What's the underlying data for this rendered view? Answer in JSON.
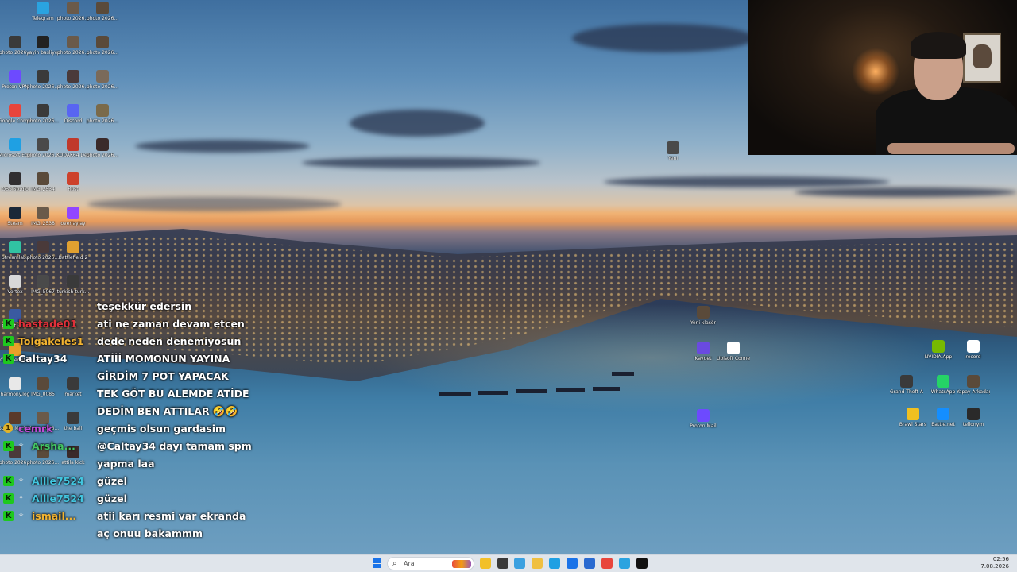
{
  "desktop": {
    "left_icons": [
      {
        "label": "Telegram",
        "icon": "telegram-icon",
        "color": "#2aa3e0"
      },
      {
        "label": "photo 2026...",
        "icon": "photo-icon",
        "color": "#6a5a4a"
      },
      {
        "label": "photo 2026...",
        "icon": "photo-icon",
        "color": "#5a4a3a"
      },
      {
        "label": "photo 2026...",
        "icon": "photo-icon",
        "color": "#3a3a3a"
      },
      {
        "label": "yayin basliyor",
        "icon": "video-icon",
        "color": "#222222"
      },
      {
        "label": "photo 2026...",
        "icon": "photo-icon",
        "color": "#6a5a4a"
      },
      {
        "label": "photo 2026...",
        "icon": "photo-icon",
        "color": "#5a4a3a"
      },
      {
        "label": "Proton VPN",
        "icon": "proton-vpn-icon",
        "color": "#6d4aff"
      },
      {
        "label": "photo 2026...",
        "icon": "photo-icon",
        "color": "#3a3a3a"
      },
      {
        "label": "photo 2026...",
        "icon": "photo-icon",
        "color": "#4a3a3a"
      },
      {
        "label": "photo 2026...",
        "icon": "photo-icon",
        "color": "#7a6a5a"
      },
      {
        "label": "Google Chrome",
        "icon": "chrome-icon",
        "color": "#e8453c"
      },
      {
        "label": "photo 2026...",
        "icon": "photo-icon",
        "color": "#3a3a3a"
      },
      {
        "label": "Discord",
        "icon": "discord-icon",
        "color": "#5865f2"
      },
      {
        "label": "photo 2026...",
        "icon": "photo-icon",
        "color": "#7a6a4a"
      },
      {
        "label": "Microsoft Edge",
        "icon": "edge-icon",
        "color": "#1fa0e3"
      },
      {
        "label": "photo 2026...",
        "icon": "photo-icon",
        "color": "#4a4a4a"
      },
      {
        "label": "KODAK64 Desktop",
        "icon": "kodak-icon",
        "color": "#c0392b"
      },
      {
        "label": "photo 2026...",
        "icon": "photo-icon",
        "color": "#3a2a2a"
      },
      {
        "label": "OBS Studio",
        "icon": "obs-icon",
        "color": "#302e31"
      },
      {
        "label": "IMG_2534",
        "icon": "photo-icon",
        "color": "#5a4a3a"
      },
      {
        "label": "Rust",
        "icon": "rust-icon",
        "color": "#cd412b"
      },
      {
        "label": "Steam",
        "icon": "steam-icon",
        "color": "#1b2838"
      },
      {
        "label": "IMG_2538",
        "icon": "photo-icon",
        "color": "#6a5a4a"
      },
      {
        "label": "overlaylay",
        "icon": "folder-icon",
        "color": "#9146ff"
      },
      {
        "label": "Streamlabs",
        "icon": "streamlabs-icon",
        "color": "#31c3a2"
      },
      {
        "label": "photo 2026...",
        "icon": "photo-icon",
        "color": "#4a3a3a"
      },
      {
        "label": "Battlefield 2",
        "icon": "game-icon",
        "color": "#e0a030"
      },
      {
        "label": "Vortex",
        "icon": "vortex-icon",
        "color": "#d8d8d8"
      },
      {
        "label": "IMG_5067",
        "icon": "photo-icon",
        "color": "#4a4a4a"
      },
      {
        "label": "turkish-turk...",
        "icon": "photo-icon",
        "color": "#3a3a3a"
      },
      {
        "label": "Cheat En...",
        "icon": "app-icon",
        "color": "#3a5aa0"
      },
      {
        "label": "Counter-St...",
        "icon": "cs-icon",
        "color": "#e8a02a"
      },
      {
        "label": "harmony.log",
        "icon": "file-icon",
        "color": "#e8e8e8"
      },
      {
        "label": "IMG_0085",
        "icon": "photo-icon",
        "color": "#5a4a3a"
      },
      {
        "label": "market",
        "icon": "photo-icon",
        "color": "#3a3a3a"
      },
      {
        "label": "Space Marine 2",
        "icon": "game-icon",
        "color": "#5a3a2a"
      },
      {
        "label": "photo 2026...",
        "icon": "photo-icon",
        "color": "#6a5a4a"
      },
      {
        "label": "the ball",
        "icon": "photo-icon",
        "color": "#3a3a3a"
      },
      {
        "label": "photo 2026...",
        "icon": "photo-icon",
        "color": "#4a3a3a"
      },
      {
        "label": "photo 2026...",
        "icon": "photo-icon",
        "color": "#5a4a3a"
      },
      {
        "label": "attila kick",
        "icon": "photo-icon",
        "color": "#3a2a2a"
      }
    ],
    "right_icons": [
      {
        "label": "Yeni klasör",
        "icon": "folder-icon",
        "color": "#5a4a3a"
      },
      {
        "label": "Yeni",
        "icon": "photo-icon",
        "color": "#4a4a4a"
      },
      {
        "label": "Kaydet",
        "icon": "app-icon",
        "color": "#6a4ae0"
      },
      {
        "label": "Ubisoft Connect",
        "icon": "ubisoft-icon",
        "color": "#ffffff"
      },
      {
        "label": "Proton Mail",
        "icon": "proton-mail-icon",
        "color": "#6d4aff"
      },
      {
        "label": "NVIDIA App",
        "icon": "nvidia-icon",
        "color": "#76b900"
      },
      {
        "label": "record",
        "icon": "record-icon",
        "color": "#ffffff"
      },
      {
        "label": "Grand Theft Auto V",
        "icon": "gta-icon",
        "color": "#3a3a3a"
      },
      {
        "label": "WhatsApp",
        "icon": "whatsapp-icon",
        "color": "#25d366"
      },
      {
        "label": "Yapay Arkadaş",
        "icon": "photo-icon",
        "color": "#5a4a3a"
      },
      {
        "label": "Brawl Stars",
        "icon": "game-icon",
        "color": "#f0c020"
      },
      {
        "label": "Battle.net",
        "icon": "battlenet-icon",
        "color": "#148eff"
      },
      {
        "label": "tellonym",
        "icon": "app-icon",
        "color": "#2a2a2a"
      }
    ]
  },
  "chat": [
    {
      "user": "",
      "user_color": "#ffffff",
      "message": "teşekkür edersin",
      "badges": []
    },
    {
      "user": "hastade01",
      "user_color": "#e0303a",
      "message": "ati ne zaman devam etcen",
      "badges": [
        "K"
      ]
    },
    {
      "user": "Tolgakeles1",
      "user_color": "#f3b431",
      "message": "dede neden denemiyosun",
      "badges": [
        "K"
      ]
    },
    {
      "user": "Caltay34",
      "user_color": "#ffffff",
      "message": "ATİİİ MOMONUN YAYINA",
      "badges": [
        "K"
      ]
    },
    {
      "user": "",
      "user_color": "#ffffff",
      "message": "GİRDİM 7 POT YAPACAK",
      "badges": []
    },
    {
      "user": "",
      "user_color": "#ffffff",
      "message": "TEK GÖT BU ALEMDE ATİDE",
      "badges": []
    },
    {
      "user": "",
      "user_color": "#ffffff",
      "message": "DEDİM BEN ATTILAR 🤣🤣",
      "badges": []
    },
    {
      "user": "cemrk",
      "user_color": "#c04ad8",
      "message": "geçmis olsun gardasim",
      "badges": [
        "1"
      ]
    },
    {
      "user": "Arsha...",
      "user_color": "#44c764",
      "message": "@Caltay34 dayı tamam spm",
      "badges": [
        "K",
        "S"
      ]
    },
    {
      "user": "",
      "user_color": "#ffffff",
      "message": "yapma laa",
      "badges": []
    },
    {
      "user": "Allle7524",
      "user_color": "#42c6e0",
      "message": "güzel",
      "badges": [
        "K",
        "S"
      ]
    },
    {
      "user": "Allle7524",
      "user_color": "#42c6e0",
      "message": "güzel",
      "badges": [
        "K",
        "S"
      ]
    },
    {
      "user": "ismail...",
      "user_color": "#f3b431",
      "message": "atii karı resmi var ekranda",
      "badges": [
        "K",
        "S"
      ]
    },
    {
      "user": "",
      "user_color": "#ffffff",
      "message": "aç onuu bakammm",
      "badges": []
    }
  ],
  "taskbar": {
    "search_placeholder": "Ara",
    "apps": [
      {
        "name": "file-explorer-icon",
        "color": "#f2c028"
      },
      {
        "name": "task-view-icon",
        "color": "#3a3a3a"
      },
      {
        "name": "copilot-icon",
        "color": "#3aa0e0"
      },
      {
        "name": "folder-icon",
        "color": "#f0c040"
      },
      {
        "name": "edge-icon",
        "color": "#1fa0e3"
      },
      {
        "name": "store-icon",
        "color": "#1a73e8"
      },
      {
        "name": "mail-icon",
        "color": "#2a6ad0"
      },
      {
        "name": "chrome-icon",
        "color": "#e8453c"
      },
      {
        "name": "telegram-icon",
        "color": "#2aa3e0"
      },
      {
        "name": "capcut-icon",
        "color": "#111111"
      },
      {
        "name": "kick-icon",
        "color": "#2ad42a"
      }
    ],
    "time": "02:56",
    "date": "7.08.2026"
  }
}
